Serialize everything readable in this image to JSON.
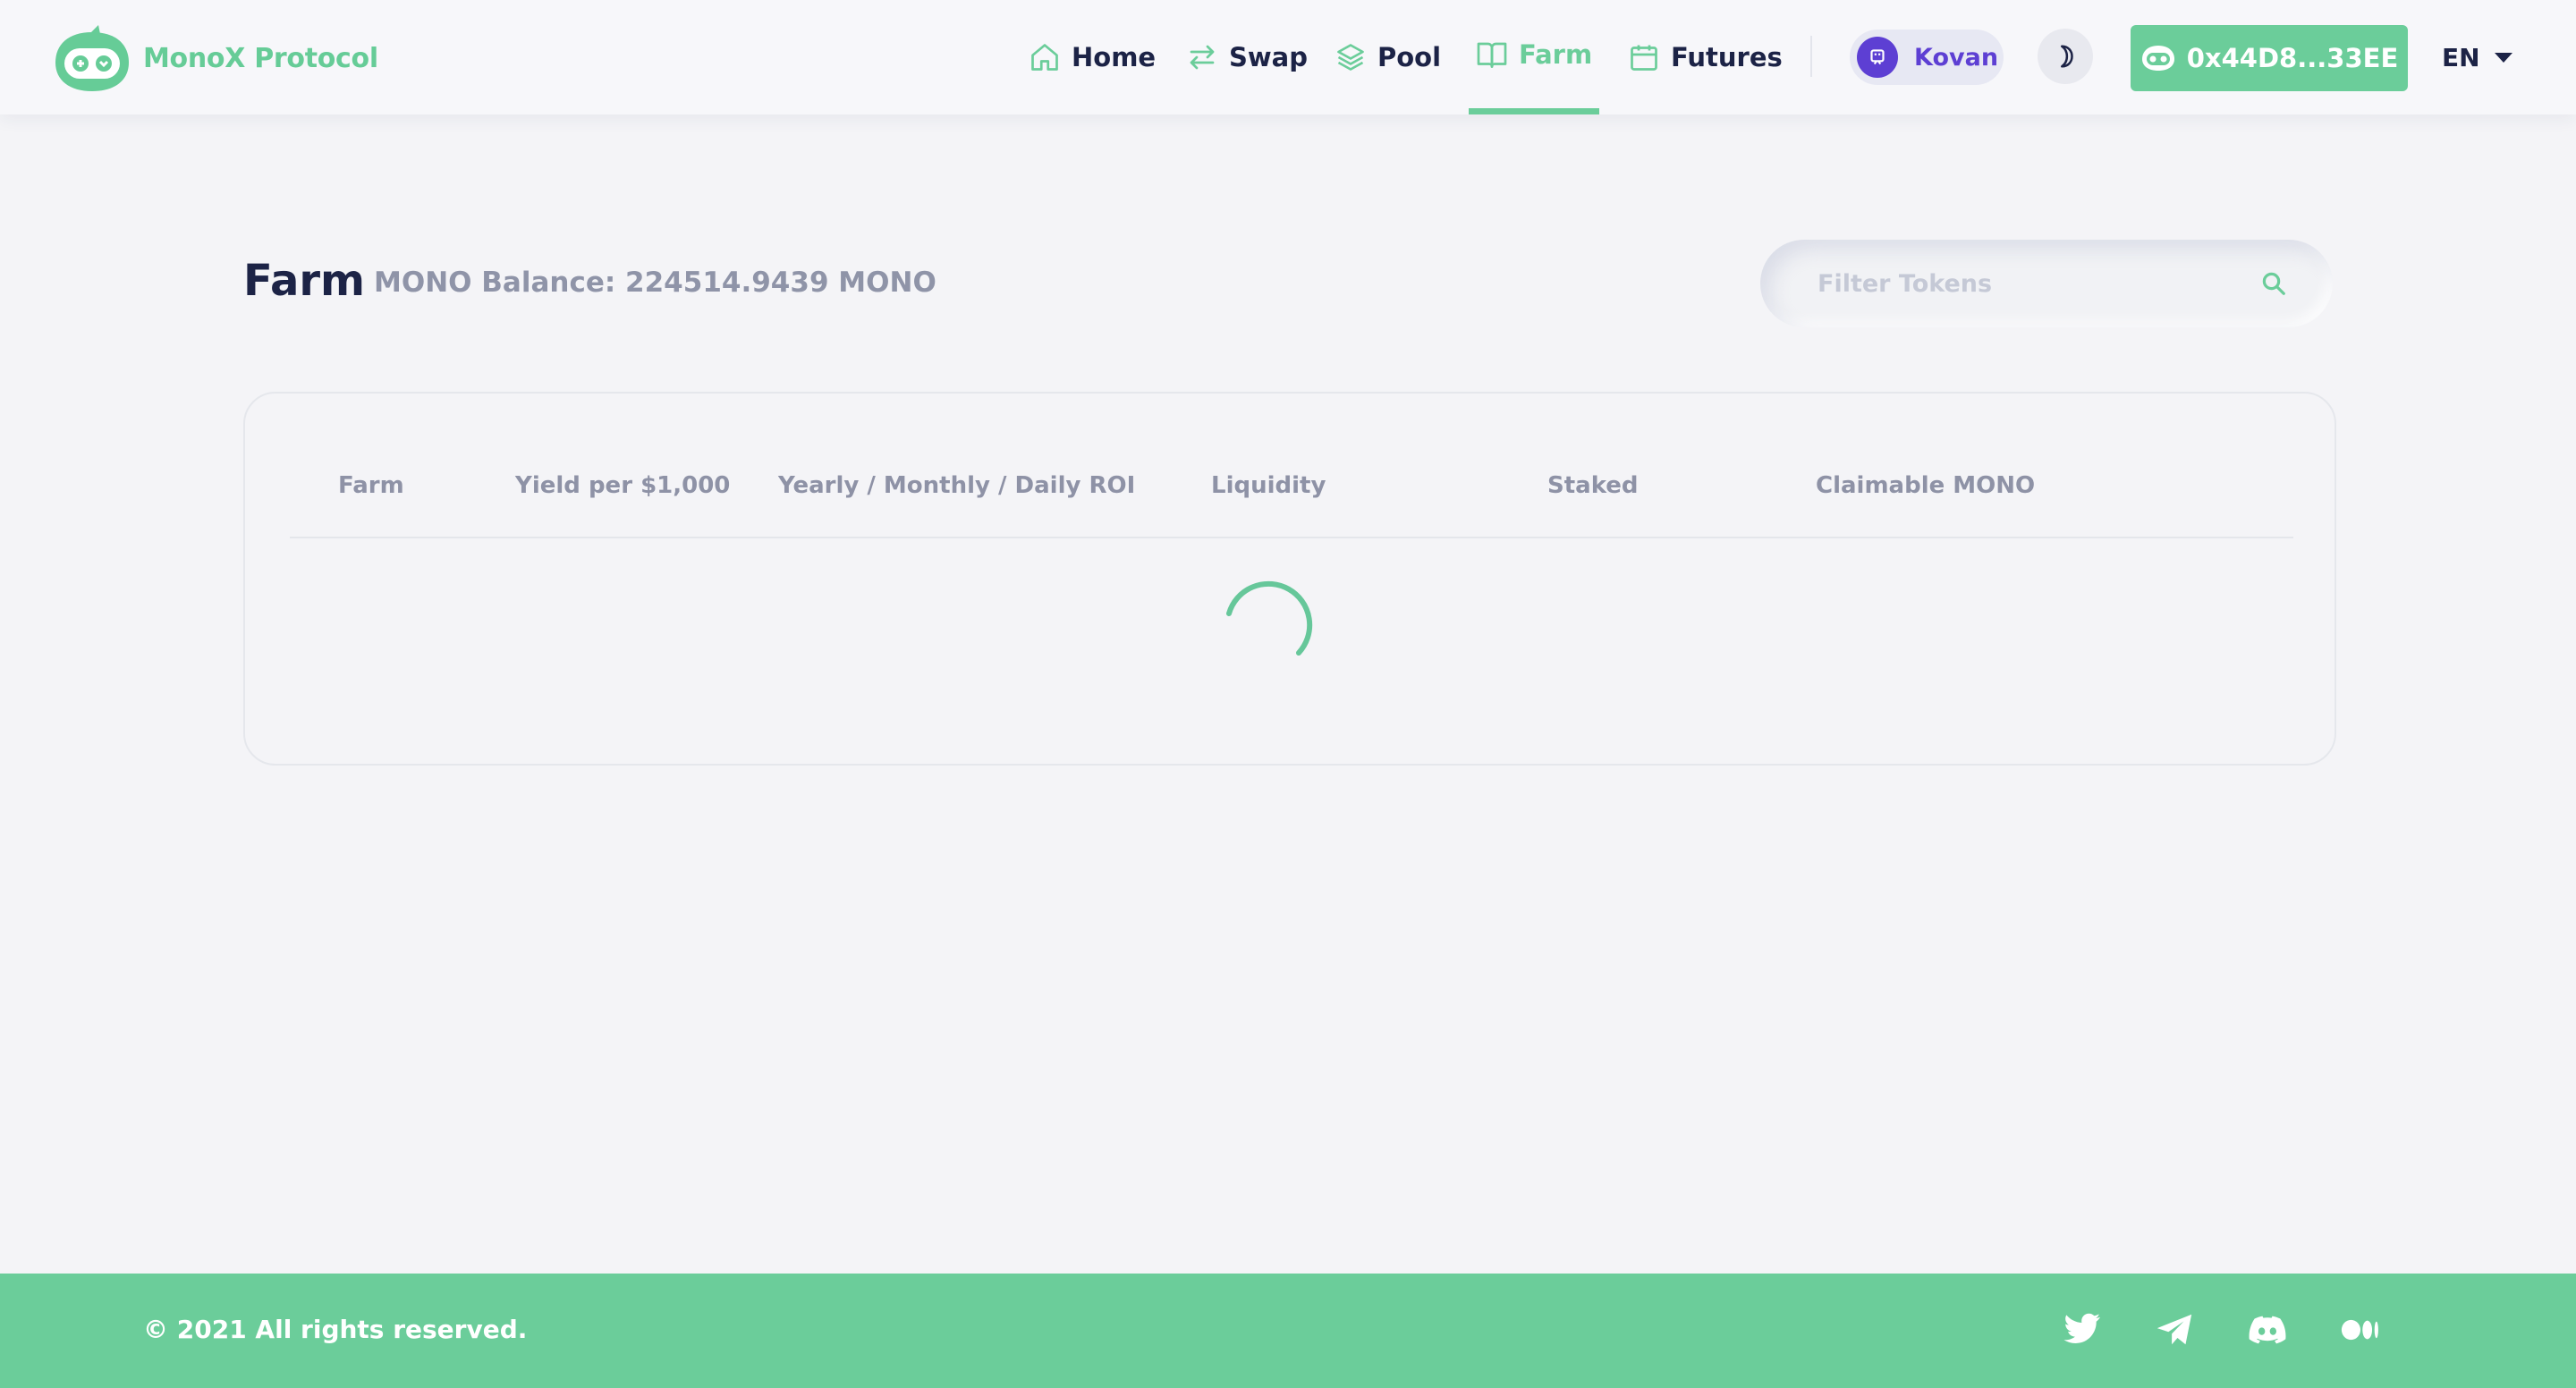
{
  "header": {
    "brand": "MonoX Protocol",
    "nav": [
      {
        "label": "Home",
        "icon": "home-icon"
      },
      {
        "label": "Swap",
        "icon": "swap-icon"
      },
      {
        "label": "Pool",
        "icon": "layers-icon"
      },
      {
        "label": "Farm",
        "icon": "book-icon",
        "active": true
      },
      {
        "label": "Futures",
        "icon": "calendar-icon"
      }
    ],
    "network": "Kovan",
    "wallet_address": "0x44D8...33EE",
    "language": "EN"
  },
  "farm": {
    "title": "Farm",
    "balance": "MONO Balance: 224514.9439 MONO",
    "search_placeholder": "Filter Tokens",
    "table_headers": [
      "Farm",
      "Yield per $1,000",
      "Yearly / Monthly / Daily ROI",
      "Liquidity",
      "Staked",
      "Claimable MONO"
    ],
    "loading": true
  },
  "footer": {
    "copyright": "© 2021 All rights reserved.",
    "social": [
      "twitter-icon",
      "telegram-icon",
      "discord-icon",
      "medium-icon"
    ]
  },
  "colors": {
    "accent": "#6bcd9a",
    "navy": "#1c2346",
    "muted": "#8e92a6",
    "network": "#5d3fd3",
    "background": "#f4f4f7"
  }
}
